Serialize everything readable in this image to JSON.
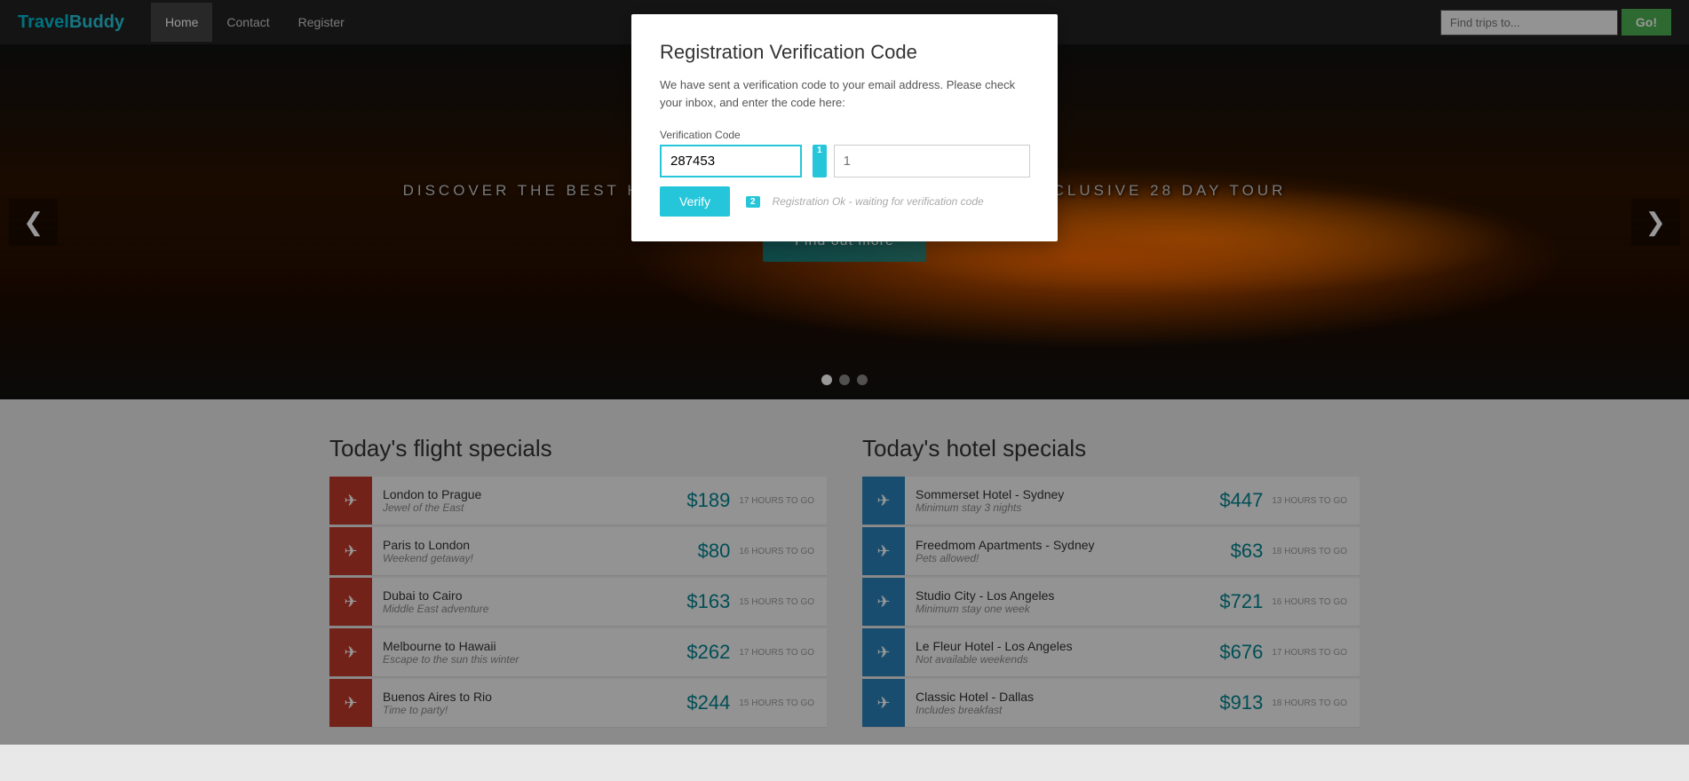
{
  "navbar": {
    "brand_prefix": "Travel",
    "brand_suffix": "Buddy",
    "links": [
      {
        "label": "Home",
        "active": true
      },
      {
        "label": "Contact",
        "active": false
      },
      {
        "label": "Register",
        "active": false
      }
    ],
    "search_placeholder": "Find trips to...",
    "go_label": "Go!"
  },
  "hero": {
    "text": "DISCOVER THE BEST HAWAII HAS TO OFFER WITH THIS ALL INCLUSIVE 28 DAY TOUR",
    "cta_label": "Find out more",
    "prev_label": "❮",
    "next_label": "❯",
    "dots": [
      true,
      false,
      false
    ]
  },
  "modal": {
    "title": "Registration Verification Code",
    "subtitle": "We have sent a verification code to your email address. Please check your inbox, and enter the code here:",
    "code_label": "Verification Code",
    "code_value": "287453",
    "code_hint": "1",
    "verify_label": "Verify",
    "status_text": "Registration Ok - waiting for verification code",
    "step1": "1",
    "step2": "2"
  },
  "flights": {
    "section_title": "Today's flight specials",
    "items": [
      {
        "name": "London to Prague",
        "sub": "Jewel of the East",
        "price": "$189",
        "time": "17 HOURS TO GO"
      },
      {
        "name": "Paris to London",
        "sub": "Weekend getaway!",
        "price": "$80",
        "time": "16 HOURS TO GO"
      },
      {
        "name": "Dubai to Cairo",
        "sub": "Middle East adventure",
        "price": "$163",
        "time": "15 HOURS TO GO"
      },
      {
        "name": "Melbourne to Hawaii",
        "sub": "Escape to the sun this winter",
        "price": "$262",
        "time": "17 HOURS TO GO"
      },
      {
        "name": "Buenos Aires to Rio",
        "sub": "Time to party!",
        "price": "$244",
        "time": "15 HOURS TO GO"
      }
    ]
  },
  "hotels": {
    "section_title": "Today's hotel specials",
    "items": [
      {
        "name": "Sommerset Hotel - Sydney",
        "sub": "Minimum stay 3 nights",
        "price": "$447",
        "time": "13 HOURS TO GO"
      },
      {
        "name": "Freedmom Apartments - Sydney",
        "sub": "Pets allowed!",
        "price": "$63",
        "time": "18 HOURS TO GO"
      },
      {
        "name": "Studio City - Los Angeles",
        "sub": "Minimum stay one week",
        "price": "$721",
        "time": "16 HOURS TO GO"
      },
      {
        "name": "Le Fleur Hotel - Los Angeles",
        "sub": "Not available weekends",
        "price": "$676",
        "time": "17 HOURS TO GO"
      },
      {
        "name": "Classic Hotel - Dallas",
        "sub": "Includes breakfast",
        "price": "$913",
        "time": "18 HOURS TO GO"
      }
    ]
  },
  "icons": {
    "plane": "✈",
    "hotel_bed": "✈"
  }
}
